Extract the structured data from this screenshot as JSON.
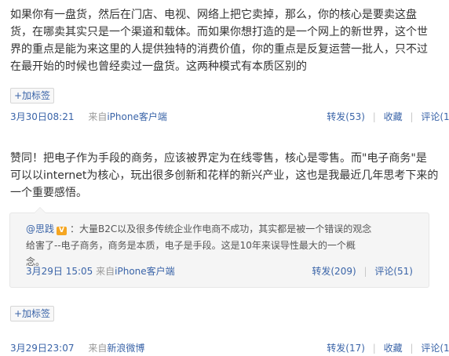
{
  "posts": [
    {
      "lines": [
        "如果你有一盘货，然后在门店、电视、网络上把它卖掉，那么，你的核心是要卖这盘",
        "货，在哪卖其实只是一个渠道和载体。而如果你想打造的是一个网上的新世界，这个世",
        "界的重点是能为来这里的人提供独特的消费价值，你的重点是反复运营一批人，只不过",
        "在最开始的时候也曾经卖过一盘货。这两种模式有本质区别的"
      ],
      "tag_label": "+加标签",
      "time": "3月30日08:21",
      "source_prefix": "来自",
      "source": "iPhone客户端",
      "repost_label": "转发(53)",
      "fav_label": "收藏",
      "comment_label": "评论(18)",
      "sep": "|"
    },
    {
      "lines": [
        "赞同！把电子作为手段的商务，应该被界定为在线零售，核心是零售。而\"电子商务\"是",
        "可以以internet为核心，玩出很多创新和花样的新兴产业，这也是我最近几年思考下来的",
        "一个重要感悟。"
      ],
      "quote": {
        "user": "@思践",
        "verified_mark": "V",
        "line1": "：大量B2C以及很多传统企业作电商不成功，其实都是被一个错误的观念",
        "line2": "给害了--电子商务，商务是本质，电子是手段。这是10年来误导性最大的一个概",
        "line3": "念。",
        "time": "3月29日 15:05",
        "source_prefix": "来自",
        "source": "iPhone客户端",
        "repost_label": "转发(209)",
        "comment_label": "评论(51)"
      },
      "tag_label": "+加标签",
      "time": "3月29日23:07",
      "source_prefix": "来自",
      "source": "新浪微博",
      "repost_label": "转发(17)",
      "fav_label": "收藏",
      "comment_label": "评论(15)",
      "sep": "|"
    }
  ],
  "colors": {
    "link": "#3a64a8",
    "muted": "#999999",
    "text": "#333333",
    "quote_bg": "#f5f5f5",
    "verified": "#f5a622"
  }
}
